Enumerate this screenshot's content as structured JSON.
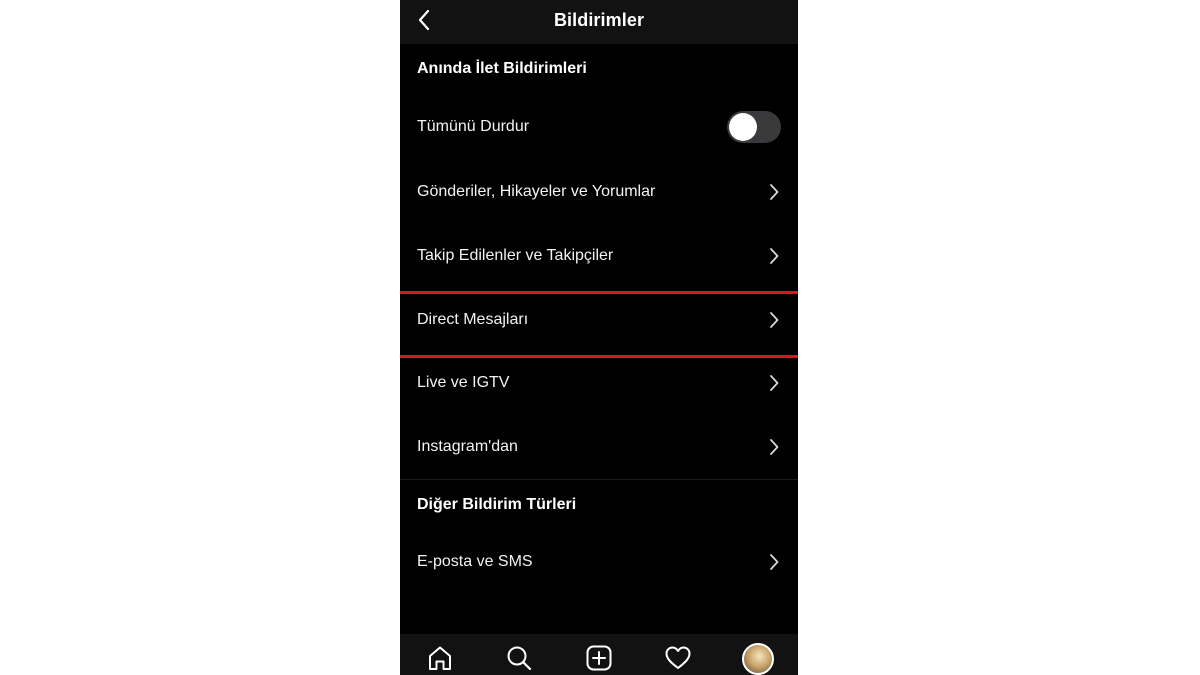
{
  "header": {
    "title": "Bildirimler",
    "back_icon": "chevron-left-icon"
  },
  "sections": {
    "push": {
      "heading": "Anında İlet Bildirimleri",
      "pause_all": {
        "label": "Tümünü Durdur",
        "enabled": false
      },
      "items": [
        {
          "label": "Gönderiler, Hikayeler ve Yorumlar"
        },
        {
          "label": "Takip Edilenler ve Takipçiler"
        },
        {
          "label": "Direct Mesajları"
        },
        {
          "label": "Live ve IGTV"
        },
        {
          "label": "Instagram'dan"
        }
      ]
    },
    "other": {
      "heading": "Diğer Bildirim Türleri",
      "items": [
        {
          "label": "E-posta ve SMS"
        }
      ]
    }
  },
  "highlight": {
    "target": "Direct Mesajları",
    "color": "#e0141b"
  },
  "tabbar": {
    "icons": [
      "home-icon",
      "search-icon",
      "add-post-icon",
      "heart-icon",
      "profile-avatar"
    ]
  },
  "colors": {
    "background": "#000000",
    "header": "#121212",
    "text": "#ffffff",
    "toggle_track": "#3a3a3c"
  }
}
